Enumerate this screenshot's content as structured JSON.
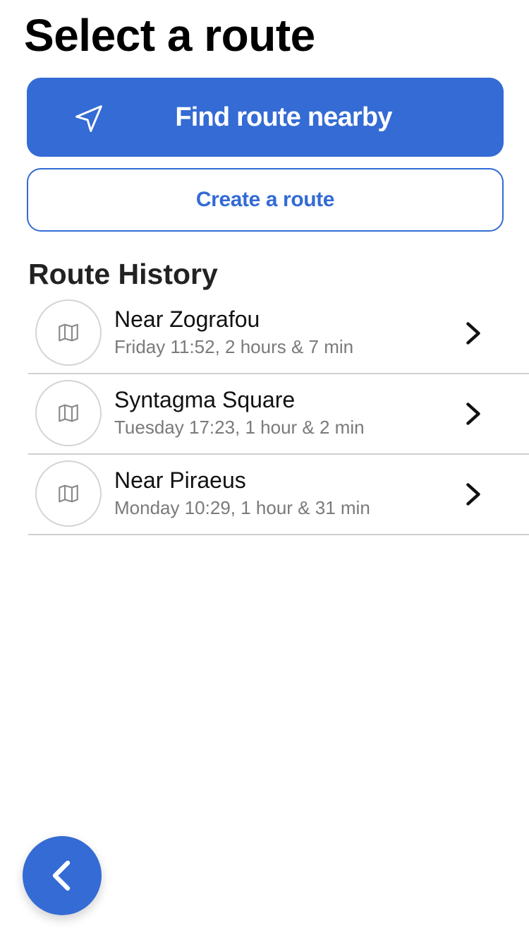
{
  "page": {
    "title": "Select a route"
  },
  "actions": {
    "find_nearby_label": "Find route nearby",
    "find_nearby_icon": "navigation-arrow-icon",
    "create_label": "Create a route"
  },
  "history": {
    "title": "Route History",
    "item_icon": "map-icon",
    "items": [
      {
        "title": "Near Zografou",
        "subtitle": "Friday 11:52, 2 hours & 7 min"
      },
      {
        "title": "Syntagma Square",
        "subtitle": "Tuesday 17:23, 1 hour & 2 min"
      },
      {
        "title": "Near Piraeus",
        "subtitle": "Monday 10:29, 1 hour & 31 min"
      }
    ]
  },
  "navigation": {
    "back_icon": "chevron-left-icon"
  },
  "colors": {
    "accent": "#346bd4",
    "divider": "#cfcfcf",
    "subtitle": "#7a7a7a"
  }
}
